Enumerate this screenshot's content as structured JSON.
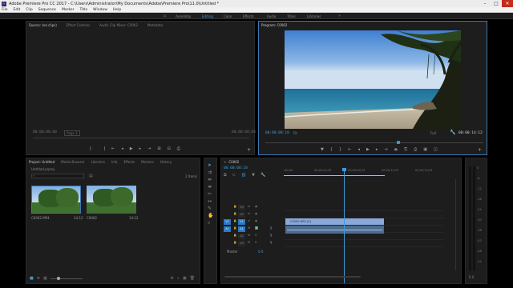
{
  "window": {
    "title": "Adobe Premiere Pro CC 2017 - C:\\Users\\Administrator\\My Documents\\Adobe\\Premiere Pro\\11.0\\Untitled *",
    "app_icon": "Pr",
    "controls": [
      "–",
      "□",
      "✕"
    ]
  },
  "menu": [
    "File",
    "Edit",
    "Clip",
    "Sequence",
    "Marker",
    "Title",
    "Window",
    "Help"
  ],
  "workspaces": {
    "tabs": [
      "Assembly",
      "Editing",
      "Color",
      "Effects",
      "Audio",
      "Titles",
      "Libraries"
    ],
    "active": "Editing",
    "more_glyph": "»",
    "home_glyph": "⌂"
  },
  "source_panel": {
    "tabs": [
      "Source: (no clips)",
      "Effect Controls",
      "Audio Clip Mixer: C0002",
      "Metadata"
    ],
    "timecode_left": "00;00;00;00",
    "timecode_right": "00;00;00;00",
    "page_label": "Page 1"
  },
  "program_panel": {
    "title": "Program: C0002",
    "timecode": "00:00:08:18",
    "fit": "Fit",
    "quality": "Full",
    "duration": "00:00:14:12",
    "playhead_fraction": 0.61
  },
  "project_panel": {
    "tabs": [
      "Project: Untitled",
      "Media Browser",
      "Libraries",
      "Info",
      "Effects",
      "Markers",
      "History"
    ],
    "project_name": "Untitled.prproj",
    "items_count": "2 Items",
    "clips": [
      {
        "name": "C0002.MP4",
        "duration": "14:12"
      },
      {
        "name": "C0002",
        "duration": "14:12"
      }
    ]
  },
  "timeline": {
    "tab": "C0002",
    "timecode": "00:00:08:18",
    "ruler": [
      ":00;00",
      "00;00;04;23",
      "00;00;09;23",
      "00;00;14;23",
      "00;00;19;23"
    ],
    "video_tracks": [
      "V3",
      "V2",
      "V1"
    ],
    "audio_tracks": [
      "A1",
      "A2",
      "A3"
    ],
    "master_label": "Master",
    "master_value": "0.0",
    "clip_label": "C0002.MP4 [V]",
    "playhead_fraction": 0.35,
    "source_patch": [
      "V1",
      "A1"
    ]
  },
  "audio_meter": {
    "scale": [
      "0",
      "-6",
      "-12",
      "-18",
      "-24",
      "-30",
      "-36",
      "-42",
      "-48",
      "-54"
    ],
    "footer": "S S"
  },
  "colors": {
    "accent": "#3b9bd9",
    "clip_video": "#8aa8d8",
    "clip_audio": "#4d6c90",
    "focus": "#2b78c5"
  }
}
